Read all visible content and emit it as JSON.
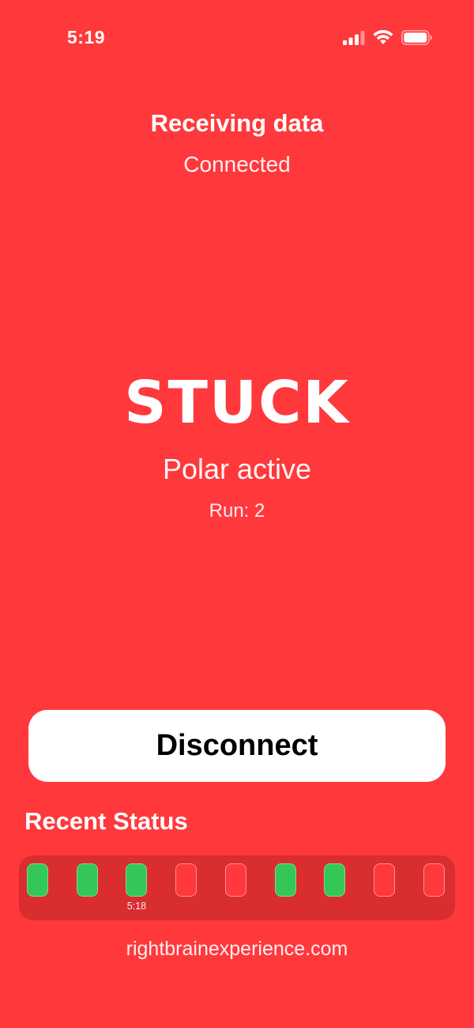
{
  "status_bar": {
    "time": "5:19",
    "icons": [
      "cellular-signal-icon",
      "wifi-icon",
      "battery-icon"
    ]
  },
  "connection": {
    "title": "Receiving data",
    "subtitle": "Connected"
  },
  "state": {
    "label": "STUCK",
    "detail": "Polar active",
    "run": "Run: 2"
  },
  "actions": {
    "disconnect_label": "Disconnect"
  },
  "recent_status": {
    "title": "Recent Status",
    "items": [
      {
        "status": "green"
      },
      {
        "status": "green"
      },
      {
        "status": "green",
        "label": "5:18"
      },
      {
        "status": "red"
      },
      {
        "status": "red"
      },
      {
        "status": "green"
      },
      {
        "status": "green"
      },
      {
        "status": "red"
      },
      {
        "status": "red"
      }
    ]
  },
  "footer": {
    "link": "rightbrainexperience.com"
  },
  "colors": {
    "background": "#FF383C",
    "timeline_bg": "#D92D30",
    "green": "#33C758",
    "button_bg": "#FFFFFF"
  }
}
